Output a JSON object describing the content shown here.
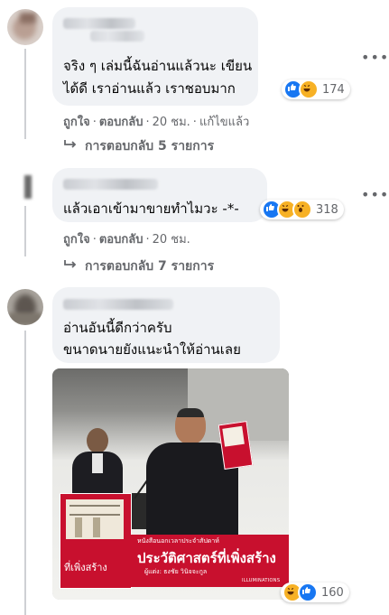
{
  "comments": [
    {
      "text_lines": [
        "จริง ๆ เล่มนี้ฉันอ่านแล้วนะ เขียน",
        "ได้ดี เราอ่านแล้ว เราชอบมาก"
      ],
      "like": "ถูกใจ",
      "reply": "ตอบกลับ",
      "time": "20 ชม.",
      "edited": "แก้ไขแล้ว",
      "reactions": [
        "like",
        "haha"
      ],
      "reaction_count": "174",
      "replies_label": "การตอบกลับ 5 รายการ"
    },
    {
      "text_lines": [
        "แล้วเอาเข้ามาขายทำไมวะ -*-"
      ],
      "like": "ถูกใจ",
      "reply": "ตอบกลับ",
      "time": "20 ชม.",
      "reactions": [
        "like",
        "haha",
        "wow"
      ],
      "reaction_count": "318",
      "replies_label": "การตอบกลับ 7 รายการ"
    },
    {
      "text_lines": [
        "อ่านอันนี้ดีกว่าครับ",
        "ขนาดนายยังแนะนำให้อ่านเลย"
      ],
      "reactions": [
        "haha",
        "like"
      ],
      "reaction_count": "160",
      "photo": {
        "book_title": "ประวัติศาสตร์ที่เพิ่งสร้าง",
        "book_subtitle": "หนังสือนอกเวลาประจำสัปดาห์",
        "book_author": "ผู้แต่ง: ธงชัย วินิจจะกูล",
        "publisher": "ILLUMINATIONS",
        "small_book_title": "ที่เพิ่งสร้าง"
      }
    }
  ],
  "colors": {
    "like": "#1877f2",
    "haha": "#f7b125",
    "wow": "#f7b125",
    "book_red": "#c8102e"
  }
}
